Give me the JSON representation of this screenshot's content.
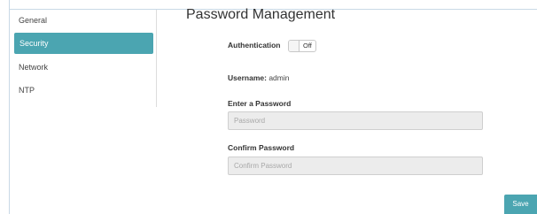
{
  "sidebar": {
    "items": [
      {
        "label": "General",
        "selected": false
      },
      {
        "label": "Security",
        "selected": true
      },
      {
        "label": "Network",
        "selected": false
      },
      {
        "label": "NTP",
        "selected": false
      }
    ]
  },
  "main": {
    "title": "Password Management",
    "authentication": {
      "label": "Authentication",
      "toggle_state": "Off"
    },
    "username": {
      "label": "Username:",
      "value": "admin"
    },
    "password": {
      "label": "Enter a Password",
      "value": "",
      "placeholder": "Password"
    },
    "confirm_password": {
      "label": "Confirm Password",
      "value": "",
      "placeholder": "Confirm Password"
    },
    "save_label": "Save"
  },
  "colors": {
    "accent": "#4ba5b1",
    "input_background": "#ececec",
    "frame_border": "#c9d9e6"
  }
}
